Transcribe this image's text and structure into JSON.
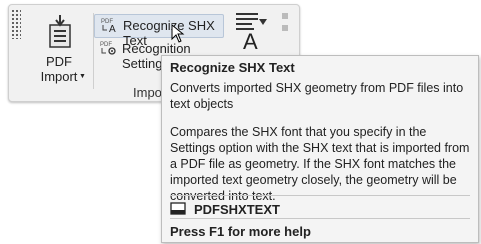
{
  "ribbon": {
    "pdf_import": {
      "line1": "PDF",
      "line2": "Import",
      "icon": "pdf-import-icon"
    },
    "recognize_label": "Recognize SHX Text",
    "settings_label": "Recognition Settings",
    "group_label": "Import"
  },
  "tooltip": {
    "title": "Recognize SHX Text",
    "description": "Converts imported SHX geometry from PDF files into text objects",
    "details": "Compares the SHX font that you specify in the Settings option with the SHX text that is imported from a PDF file as geometry. If the SHX font matches the imported text geometry closely, the geometry will be converted into text.",
    "command": "PDFSHXTEXT",
    "help": "Press F1 for more help"
  }
}
